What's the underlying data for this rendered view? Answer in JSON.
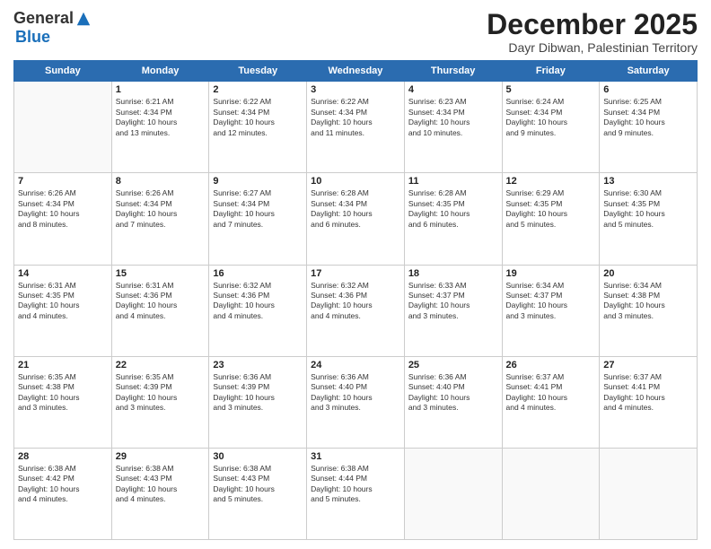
{
  "logo": {
    "general": "General",
    "blue": "Blue"
  },
  "title": "December 2025",
  "subtitle": "Dayr Dibwan, Palestinian Territory",
  "days_of_week": [
    "Sunday",
    "Monday",
    "Tuesday",
    "Wednesday",
    "Thursday",
    "Friday",
    "Saturday"
  ],
  "weeks": [
    [
      {
        "day": null,
        "info": null
      },
      {
        "day": "1",
        "info": "Sunrise: 6:21 AM\nSunset: 4:34 PM\nDaylight: 10 hours\nand 13 minutes."
      },
      {
        "day": "2",
        "info": "Sunrise: 6:22 AM\nSunset: 4:34 PM\nDaylight: 10 hours\nand 12 minutes."
      },
      {
        "day": "3",
        "info": "Sunrise: 6:22 AM\nSunset: 4:34 PM\nDaylight: 10 hours\nand 11 minutes."
      },
      {
        "day": "4",
        "info": "Sunrise: 6:23 AM\nSunset: 4:34 PM\nDaylight: 10 hours\nand 10 minutes."
      },
      {
        "day": "5",
        "info": "Sunrise: 6:24 AM\nSunset: 4:34 PM\nDaylight: 10 hours\nand 9 minutes."
      },
      {
        "day": "6",
        "info": "Sunrise: 6:25 AM\nSunset: 4:34 PM\nDaylight: 10 hours\nand 9 minutes."
      }
    ],
    [
      {
        "day": "7",
        "info": "Sunrise: 6:26 AM\nSunset: 4:34 PM\nDaylight: 10 hours\nand 8 minutes."
      },
      {
        "day": "8",
        "info": "Sunrise: 6:26 AM\nSunset: 4:34 PM\nDaylight: 10 hours\nand 7 minutes."
      },
      {
        "day": "9",
        "info": "Sunrise: 6:27 AM\nSunset: 4:34 PM\nDaylight: 10 hours\nand 7 minutes."
      },
      {
        "day": "10",
        "info": "Sunrise: 6:28 AM\nSunset: 4:34 PM\nDaylight: 10 hours\nand 6 minutes."
      },
      {
        "day": "11",
        "info": "Sunrise: 6:28 AM\nSunset: 4:35 PM\nDaylight: 10 hours\nand 6 minutes."
      },
      {
        "day": "12",
        "info": "Sunrise: 6:29 AM\nSunset: 4:35 PM\nDaylight: 10 hours\nand 5 minutes."
      },
      {
        "day": "13",
        "info": "Sunrise: 6:30 AM\nSunset: 4:35 PM\nDaylight: 10 hours\nand 5 minutes."
      }
    ],
    [
      {
        "day": "14",
        "info": "Sunrise: 6:31 AM\nSunset: 4:35 PM\nDaylight: 10 hours\nand 4 minutes."
      },
      {
        "day": "15",
        "info": "Sunrise: 6:31 AM\nSunset: 4:36 PM\nDaylight: 10 hours\nand 4 minutes."
      },
      {
        "day": "16",
        "info": "Sunrise: 6:32 AM\nSunset: 4:36 PM\nDaylight: 10 hours\nand 4 minutes."
      },
      {
        "day": "17",
        "info": "Sunrise: 6:32 AM\nSunset: 4:36 PM\nDaylight: 10 hours\nand 4 minutes."
      },
      {
        "day": "18",
        "info": "Sunrise: 6:33 AM\nSunset: 4:37 PM\nDaylight: 10 hours\nand 3 minutes."
      },
      {
        "day": "19",
        "info": "Sunrise: 6:34 AM\nSunset: 4:37 PM\nDaylight: 10 hours\nand 3 minutes."
      },
      {
        "day": "20",
        "info": "Sunrise: 6:34 AM\nSunset: 4:38 PM\nDaylight: 10 hours\nand 3 minutes."
      }
    ],
    [
      {
        "day": "21",
        "info": "Sunrise: 6:35 AM\nSunset: 4:38 PM\nDaylight: 10 hours\nand 3 minutes."
      },
      {
        "day": "22",
        "info": "Sunrise: 6:35 AM\nSunset: 4:39 PM\nDaylight: 10 hours\nand 3 minutes."
      },
      {
        "day": "23",
        "info": "Sunrise: 6:36 AM\nSunset: 4:39 PM\nDaylight: 10 hours\nand 3 minutes."
      },
      {
        "day": "24",
        "info": "Sunrise: 6:36 AM\nSunset: 4:40 PM\nDaylight: 10 hours\nand 3 minutes."
      },
      {
        "day": "25",
        "info": "Sunrise: 6:36 AM\nSunset: 4:40 PM\nDaylight: 10 hours\nand 3 minutes."
      },
      {
        "day": "26",
        "info": "Sunrise: 6:37 AM\nSunset: 4:41 PM\nDaylight: 10 hours\nand 4 minutes."
      },
      {
        "day": "27",
        "info": "Sunrise: 6:37 AM\nSunset: 4:41 PM\nDaylight: 10 hours\nand 4 minutes."
      }
    ],
    [
      {
        "day": "28",
        "info": "Sunrise: 6:38 AM\nSunset: 4:42 PM\nDaylight: 10 hours\nand 4 minutes."
      },
      {
        "day": "29",
        "info": "Sunrise: 6:38 AM\nSunset: 4:43 PM\nDaylight: 10 hours\nand 4 minutes."
      },
      {
        "day": "30",
        "info": "Sunrise: 6:38 AM\nSunset: 4:43 PM\nDaylight: 10 hours\nand 5 minutes."
      },
      {
        "day": "31",
        "info": "Sunrise: 6:38 AM\nSunset: 4:44 PM\nDaylight: 10 hours\nand 5 minutes."
      },
      {
        "day": null,
        "info": null
      },
      {
        "day": null,
        "info": null
      },
      {
        "day": null,
        "info": null
      }
    ]
  ]
}
